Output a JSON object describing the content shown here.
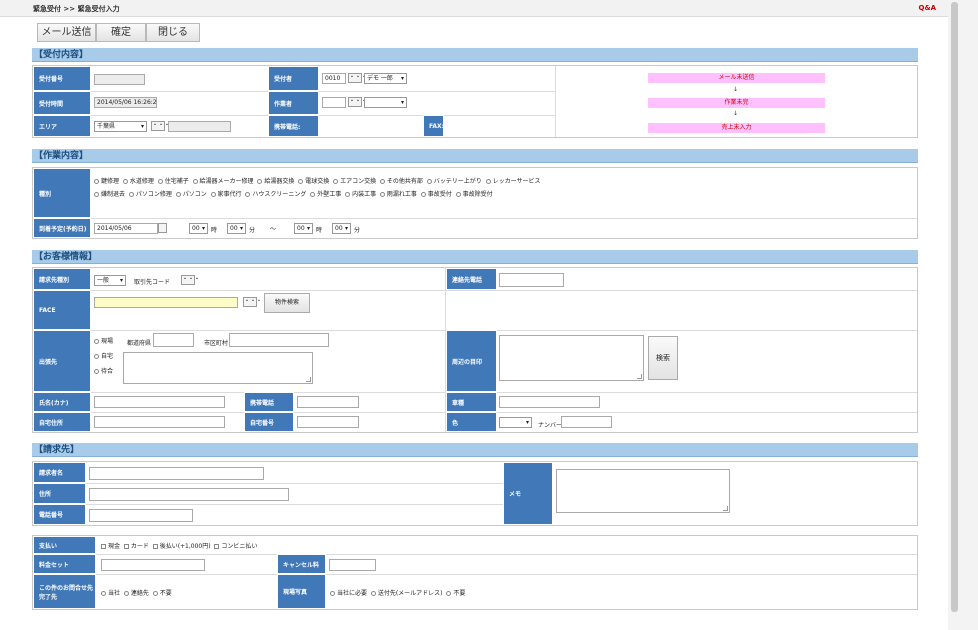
{
  "header": {
    "breadcrumb": "緊急受付 >> 緊急受付入力",
    "qa_link": "Q&A"
  },
  "toolbar": {
    "send_mail": "メール送信",
    "confirm": "確定",
    "close": "閉じる"
  },
  "reception": {
    "title": "【受付内容】",
    "labels": {
      "number": "受付番号",
      "datetime": "受付時間",
      "area": "エリア",
      "receiver": "受付者",
      "worker": "作業者",
      "mobile": "携帯電話:",
      "fax": "FAX:"
    },
    "datetime_value": "2014/05/06 16:26:27",
    "area_value": "千葉県",
    "receiver_code": "0010",
    "receiver_name": "デモ 一郎",
    "dots": "・・・",
    "status": [
      "メール未送信",
      "作業未完",
      "売上未入力"
    ],
    "arrow": "↓"
  },
  "work": {
    "title": "【作業内容】",
    "labels": {
      "category": "種別",
      "schedule": "到着予定(予約日)"
    },
    "categories_row1": [
      "鍵修理",
      "水道修理",
      "住宅補子",
      "給湯器メーカー修理",
      "給湯器交換",
      "電球交換",
      "エアコン交換",
      "その他共有部",
      "バッテリー上がり",
      "レッカーサービス"
    ],
    "categories_row2": [
      "嫌制退去",
      "パソコン修理",
      "パソコン",
      "家事代行",
      "ハウスクリーニング",
      "外壁工事",
      "内装工事",
      "雨漏れ工事",
      "事故受付",
      "事故除受付"
    ],
    "date": "2014/05/06",
    "hour1": "00",
    "hour2": "00",
    "min1": "00",
    "min2": "00",
    "hour_unit": "時",
    "min_unit": "分",
    "tilde": "〜"
  },
  "customer": {
    "title": "【お客様情報】",
    "labels": {
      "billing_type": "請求先種別",
      "face": "FACE",
      "dispatch": "出張先",
      "name_kana": "氏名(カナ)",
      "home_address": "自宅住所",
      "mobile": "携帯電話",
      "home_number": "自宅番号",
      "contact_phone": "連絡先電話",
      "landmark": "周辺の目印",
      "car_type": "車種",
      "color": "色"
    },
    "billing_type_value": "一般",
    "client_code_label": "取引先コード",
    "property_search": "物件検索",
    "dispatch_options": [
      "現場",
      "自宅",
      "待合"
    ],
    "prefecture_label": "都道府県",
    "city_label": "市区町村",
    "search_button": "検索",
    "number_label": "ナンバー"
  },
  "billing": {
    "title": "【請求先】",
    "labels": {
      "name": "請求者名",
      "address": "住所",
      "phone": "電話番号",
      "memo": "メモ"
    }
  },
  "payment": {
    "labels": {
      "method": "支払い",
      "fee_set": "料金セット",
      "cancel_fee": "キャンセル料",
      "inquiry_line1": "この件のお問合せ先",
      "inquiry_line2": "完了先",
      "photo": "現場写真"
    },
    "methods": [
      "現金",
      "カード",
      "後払い(+1,000円)",
      "コンビニ払い"
    ],
    "inquiry_options": [
      "当社",
      "連絡先",
      "不要"
    ],
    "photo_options": [
      "当社に必要",
      "送付先(メールアドレス)",
      "不要"
    ]
  }
}
